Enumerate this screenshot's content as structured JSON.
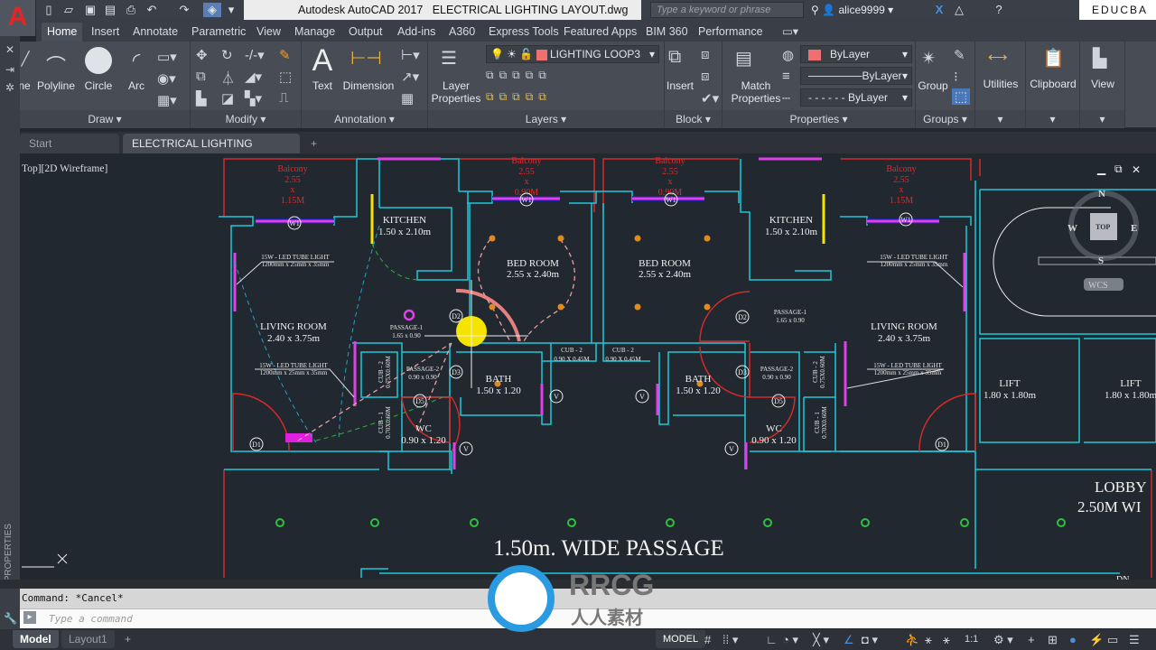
{
  "app": {
    "title": "Autodesk AutoCAD 2017",
    "file": "ELECTRICAL LIGHTING LAYOUT.dwg",
    "logo_letter": "A"
  },
  "search": {
    "placeholder": "Type a keyword or phrase"
  },
  "user": {
    "name": "alice9999"
  },
  "brand": {
    "educba": "EDUCBA"
  },
  "ribbon_tabs": [
    "Home",
    "Insert",
    "Annotate",
    "Parametric",
    "View",
    "Manage",
    "Output",
    "Add-ins",
    "A360",
    "Express Tools",
    "Featured Apps",
    "BIM 360",
    "Performance"
  ],
  "panels": {
    "draw": {
      "title": "Draw",
      "items": [
        "ne",
        "Polyline",
        "Circle",
        "Arc"
      ]
    },
    "modify": {
      "title": "Modify"
    },
    "annotation": {
      "title": "Annotation",
      "items": [
        "Text",
        "Dimension"
      ]
    },
    "layers": {
      "title": "Layers",
      "layer_properties": "Layer Properties",
      "current_layer": "LIGHTING LOOP3",
      "layer_color": "#f07070"
    },
    "block": {
      "title": "Block",
      "insert": "Insert"
    },
    "properties": {
      "title": "Properties",
      "match": "Match Properties",
      "color": "ByLayer",
      "linetype": "ByLayer",
      "lineweight": "ByLayer",
      "color_swatch": "#f07070"
    },
    "groups": {
      "title": "Groups",
      "group": "Group"
    },
    "utilities": "Utilities",
    "clipboard": "Clipboard",
    "view": "View"
  },
  "file_tabs": [
    "Start",
    "ELECTRICAL LIGHTING LAYOUT*"
  ],
  "viewport": {
    "label": "Top][2D Wireframe]",
    "compass": {
      "n": "N",
      "s": "S",
      "e": "E",
      "w": "W",
      "top": "TOP"
    },
    "ucs": "WCS"
  },
  "drawing": {
    "balcony": [
      "Balcony",
      "2.55",
      "x",
      "1.15M",
      "0.90M"
    ],
    "kitchen": [
      "KITCHEN",
      "1.50 x 2.10m"
    ],
    "bedroom": [
      "BED ROOM",
      "2.55 x 2.40m"
    ],
    "living": [
      "LIVING ROOM",
      "2.40 x 3.75m"
    ],
    "tube_light": [
      "15W - LED TUBE LIGHT",
      "1200mm x 25mm x 35mm"
    ],
    "passage1": [
      "PASSAGE-1",
      "1.65 x 0.90"
    ],
    "passage2": [
      "PASSAGE-2",
      "0.90 x 0.90"
    ],
    "cub2h": [
      "CUB - 2",
      "0.90 X 0.45M"
    ],
    "cub2v": [
      "CUB - 2",
      "0.75X0.60M"
    ],
    "cub1": [
      "CUB - 1",
      "0.70X0.60M"
    ],
    "bath": [
      "BATH",
      "1.50 x 1.20"
    ],
    "wc": [
      "WC",
      "0.90 x 1.20"
    ],
    "lift": [
      "LIFT",
      "1.80 x 1.80m"
    ],
    "lobby": [
      "LOBBY",
      "2.50M WI"
    ],
    "passage_title": "1.50m. WIDE PASSAGE",
    "dn": "DN",
    "tags": {
      "w1": "W1",
      "d1": "D1",
      "d2": "D2",
      "d3": "D3",
      "d5": "D5",
      "v": "V"
    }
  },
  "command": {
    "history": "Command: *Cancel*",
    "placeholder": "Type a command"
  },
  "status": {
    "tabs": [
      "Model",
      "Layout1"
    ],
    "mode": "MODEL",
    "scale": "1:1"
  },
  "watermark": {
    "logo": "RRCG",
    "sub": "人人素材"
  },
  "palette": {
    "properties": "PROPERTIES"
  },
  "colors": {
    "wall": "#1fc8d8",
    "outline": "#d42a2a",
    "fixture": "#e040e8",
    "window": "#2020a0",
    "accent": "#f5e400",
    "bg": "#212830"
  }
}
